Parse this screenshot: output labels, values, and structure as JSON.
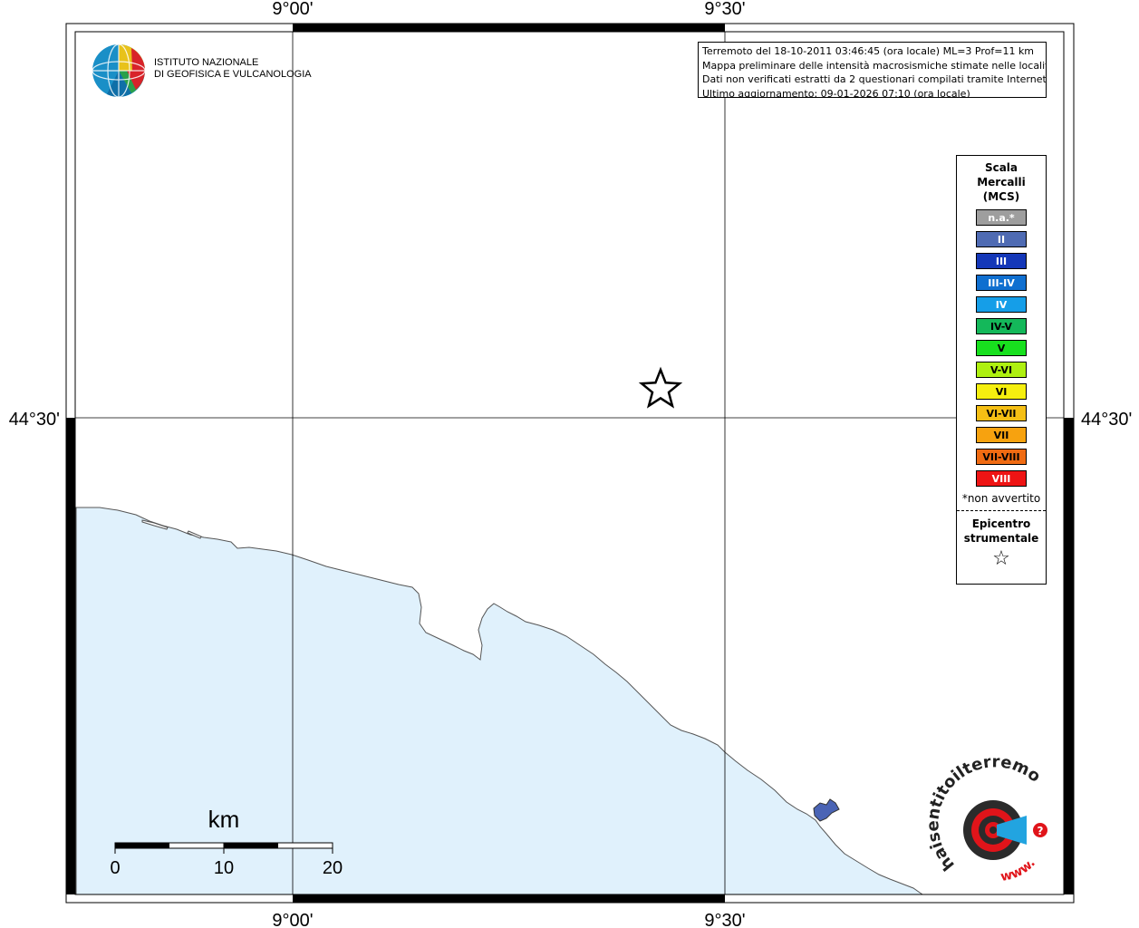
{
  "info": {
    "line1": "Terremoto del 18-10-2011 03:46:45 (ora locale) ML=3 Prof=11 km",
    "line2": "Mappa preliminare delle intensità macrosismiche stimate nelle località",
    "line3": "Dati non verificati estratti da 2 questionari compilati tramite Internet.",
    "line4": "Ultimo aggiornamento: 09-01-2026 07:10 (ora locale)"
  },
  "axes": {
    "top_left": "9°00'",
    "top_right": "9°30'",
    "bottom_left": "9°00'",
    "bottom_right": "9°30'",
    "left_lat": "44°30'",
    "right_lat": "44°30'"
  },
  "logo": {
    "line1": "ISTITUTO NAZIONALE",
    "line2": "DI GEOFISICA E VULCANOLOGIA"
  },
  "legend": {
    "title1": "Scala",
    "title2": "Mercalli",
    "title3": "(MCS)",
    "items": [
      {
        "label": "n.a.*",
        "color": "#9e9e9e"
      },
      {
        "label": "II",
        "color": "#4f6bb3"
      },
      {
        "label": "III",
        "color": "#1437b8"
      },
      {
        "label": "III-IV",
        "color": "#0f6fd0"
      },
      {
        "label": "IV",
        "color": "#159ee8"
      },
      {
        "label": "IV-V",
        "color": "#14b85a"
      },
      {
        "label": "V",
        "color": "#18e01e"
      },
      {
        "label": "V-VI",
        "color": "#aef010"
      },
      {
        "label": "VI",
        "color": "#f5ef0f"
      },
      {
        "label": "VI-VII",
        "color": "#f5bf14"
      },
      {
        "label": "VII",
        "color": "#f7a20f"
      },
      {
        "label": "VII-VIII",
        "color": "#f06b12"
      },
      {
        "label": "VIII",
        "color": "#ee1414"
      }
    ],
    "note": "*non avvertito",
    "epi1": "Epicentro",
    "epi2": "strumentale",
    "star": "☆"
  },
  "scale": {
    "unit": "km",
    "ticks": [
      "0",
      "10",
      "20"
    ]
  },
  "hsh_logo": {
    "text": "haisentitoilterremoto.it",
    "www": "www."
  },
  "colors": {
    "sea": "#e0f1fc",
    "lake": "#4a64b5"
  },
  "epicenter": {
    "lon": 9.4833,
    "lat": 44.5367
  }
}
